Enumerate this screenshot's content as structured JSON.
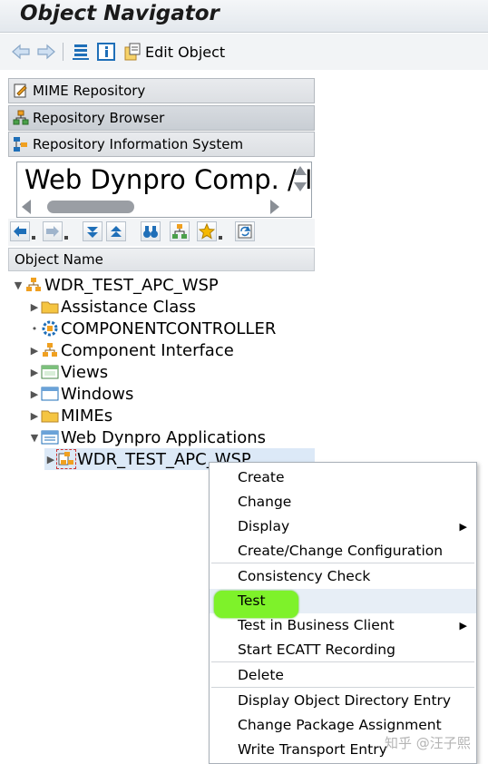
{
  "title": "Object Navigator",
  "toolbar": {
    "edit_object_label": "Edit Object"
  },
  "nav_buttons": [
    {
      "label": "MIME Repository",
      "icon": "mime-icon"
    },
    {
      "label": "Repository Browser",
      "icon": "hierarchy-icon"
    },
    {
      "label": "Repository Information System",
      "icon": "info-system-icon"
    }
  ],
  "object_type_selector": {
    "value": "Web Dynpro Comp. / I"
  },
  "tree": {
    "column_header": "Object Name",
    "root": "WDR_TEST_APC_WSP",
    "items": [
      {
        "label": "Assistance Class",
        "icon": "folder-icon"
      },
      {
        "label": "COMPONENTCONTROLLER",
        "icon": "controller-icon"
      },
      {
        "label": "Component Interface",
        "icon": "component-icon"
      },
      {
        "label": "Views",
        "icon": "views-icon"
      },
      {
        "label": "Windows",
        "icon": "windows-icon"
      },
      {
        "label": "MIMEs",
        "icon": "folder-icon"
      },
      {
        "label": "Web Dynpro Applications",
        "icon": "applications-icon"
      }
    ],
    "selected_child": "WDR_TEST_APC_WSP"
  },
  "context_menu": {
    "items": [
      {
        "label": "Create",
        "submenu": false
      },
      {
        "label": "Change",
        "submenu": false
      },
      {
        "label": "Display",
        "submenu": true
      },
      {
        "label": "Create/Change Configuration",
        "submenu": false
      },
      {
        "label": "Consistency Check",
        "submenu": false
      },
      {
        "label": "Test",
        "submenu": false
      },
      {
        "label": "Test in Business Client",
        "submenu": true
      },
      {
        "label": "Start ECATT Recording",
        "submenu": false
      },
      {
        "label": "Delete",
        "submenu": false
      },
      {
        "label": "Display Object Directory Entry",
        "submenu": false
      },
      {
        "label": "Change Package Assignment",
        "submenu": false
      },
      {
        "label": "Write Transport Entry",
        "submenu": false
      }
    ],
    "highlight_color": "#7ef22a"
  },
  "watermark": "知乎 @汪子熙",
  "colors": {
    "selection": "#dce9f7",
    "icon_blue": "#1f6fb8",
    "icon_orange": "#f0a020"
  }
}
